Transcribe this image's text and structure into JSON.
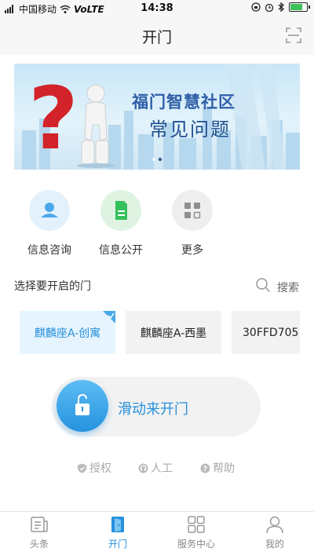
{
  "status_bar": {
    "carrier": "中国移动",
    "network": "VoLTE",
    "time": "14:38"
  },
  "header": {
    "title": "开门",
    "scan_icon": "scan-icon"
  },
  "banner": {
    "title_line1": "福门智慧社区",
    "title_line2": "常见问题",
    "page_count": 2,
    "active_page": 2
  },
  "quick_actions": [
    {
      "label": "信息咨询",
      "icon": "person-icon",
      "color": "#4aa8ea"
    },
    {
      "label": "信息公开",
      "icon": "document-icon",
      "color": "#34c15b"
    },
    {
      "label": "更多",
      "icon": "grid-icon",
      "color": "#8f8f8f"
    }
  ],
  "door_section": {
    "title": "选择要开启的门",
    "search_label": "搜索",
    "doors": [
      {
        "label": "麒麟座A-创寓",
        "selected": true
      },
      {
        "label": "麒麟座A-西墨",
        "selected": false
      },
      {
        "label": "30FFD705",
        "selected": false
      }
    ]
  },
  "slider": {
    "label": "滑动来开门",
    "icon": "unlock-icon"
  },
  "footer_links": [
    {
      "label": "授权",
      "icon": "shield-icon"
    },
    {
      "label": "人工",
      "icon": "headset-icon"
    },
    {
      "label": "帮助",
      "icon": "help-icon"
    }
  ],
  "tab_bar": [
    {
      "label": "头条",
      "icon": "news-icon",
      "active": false
    },
    {
      "label": "开门",
      "icon": "door-icon",
      "active": true
    },
    {
      "label": "服务中心",
      "icon": "grid-icon",
      "active": false
    },
    {
      "label": "我的",
      "icon": "profile-icon",
      "active": false
    }
  ],
  "colors": {
    "accent": "#2590dc",
    "header_bg": "#f7f7f7"
  }
}
